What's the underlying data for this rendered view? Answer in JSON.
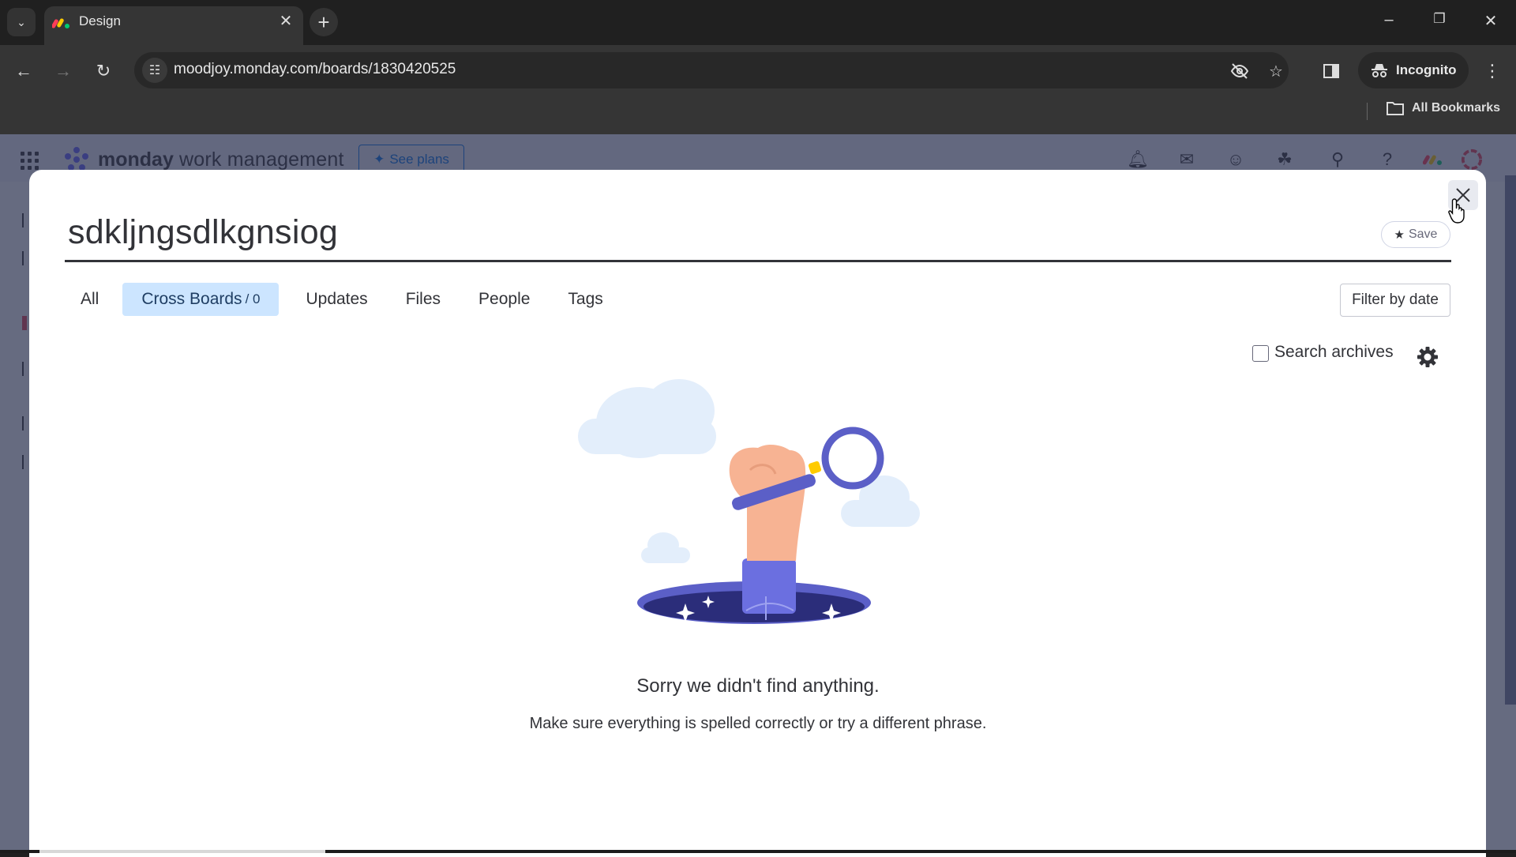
{
  "browser": {
    "tab_title": "Design",
    "url": "moodjoy.monday.com/boards/1830420525",
    "incognito_label": "Incognito",
    "bookmarks_label": "All Bookmarks"
  },
  "app": {
    "brand_bold": "monday",
    "brand_rest": " work management",
    "see_plans_label": "See plans"
  },
  "search": {
    "query": "sdkljngsdlkgnsiog",
    "save_label": "Save",
    "tabs": [
      {
        "label": "All",
        "active": false
      },
      {
        "label": "Cross Boards",
        "count": "/ 0",
        "active": true
      },
      {
        "label": "Updates",
        "active": false
      },
      {
        "label": "Files",
        "active": false
      },
      {
        "label": "People",
        "active": false
      },
      {
        "label": "Tags",
        "active": false
      }
    ],
    "filter_by_date_label": "Filter by date",
    "search_archives_label": "Search archives",
    "search_archives_checked": false,
    "empty_title": "Sorry we didn't find anything.",
    "empty_subtitle": "Make sure everything is spelled correctly or try a different phrase."
  },
  "colors": {
    "accent": "#0073ea",
    "active_tab_bg": "#cce5ff",
    "illustration_purple": "#5b5fc7"
  }
}
